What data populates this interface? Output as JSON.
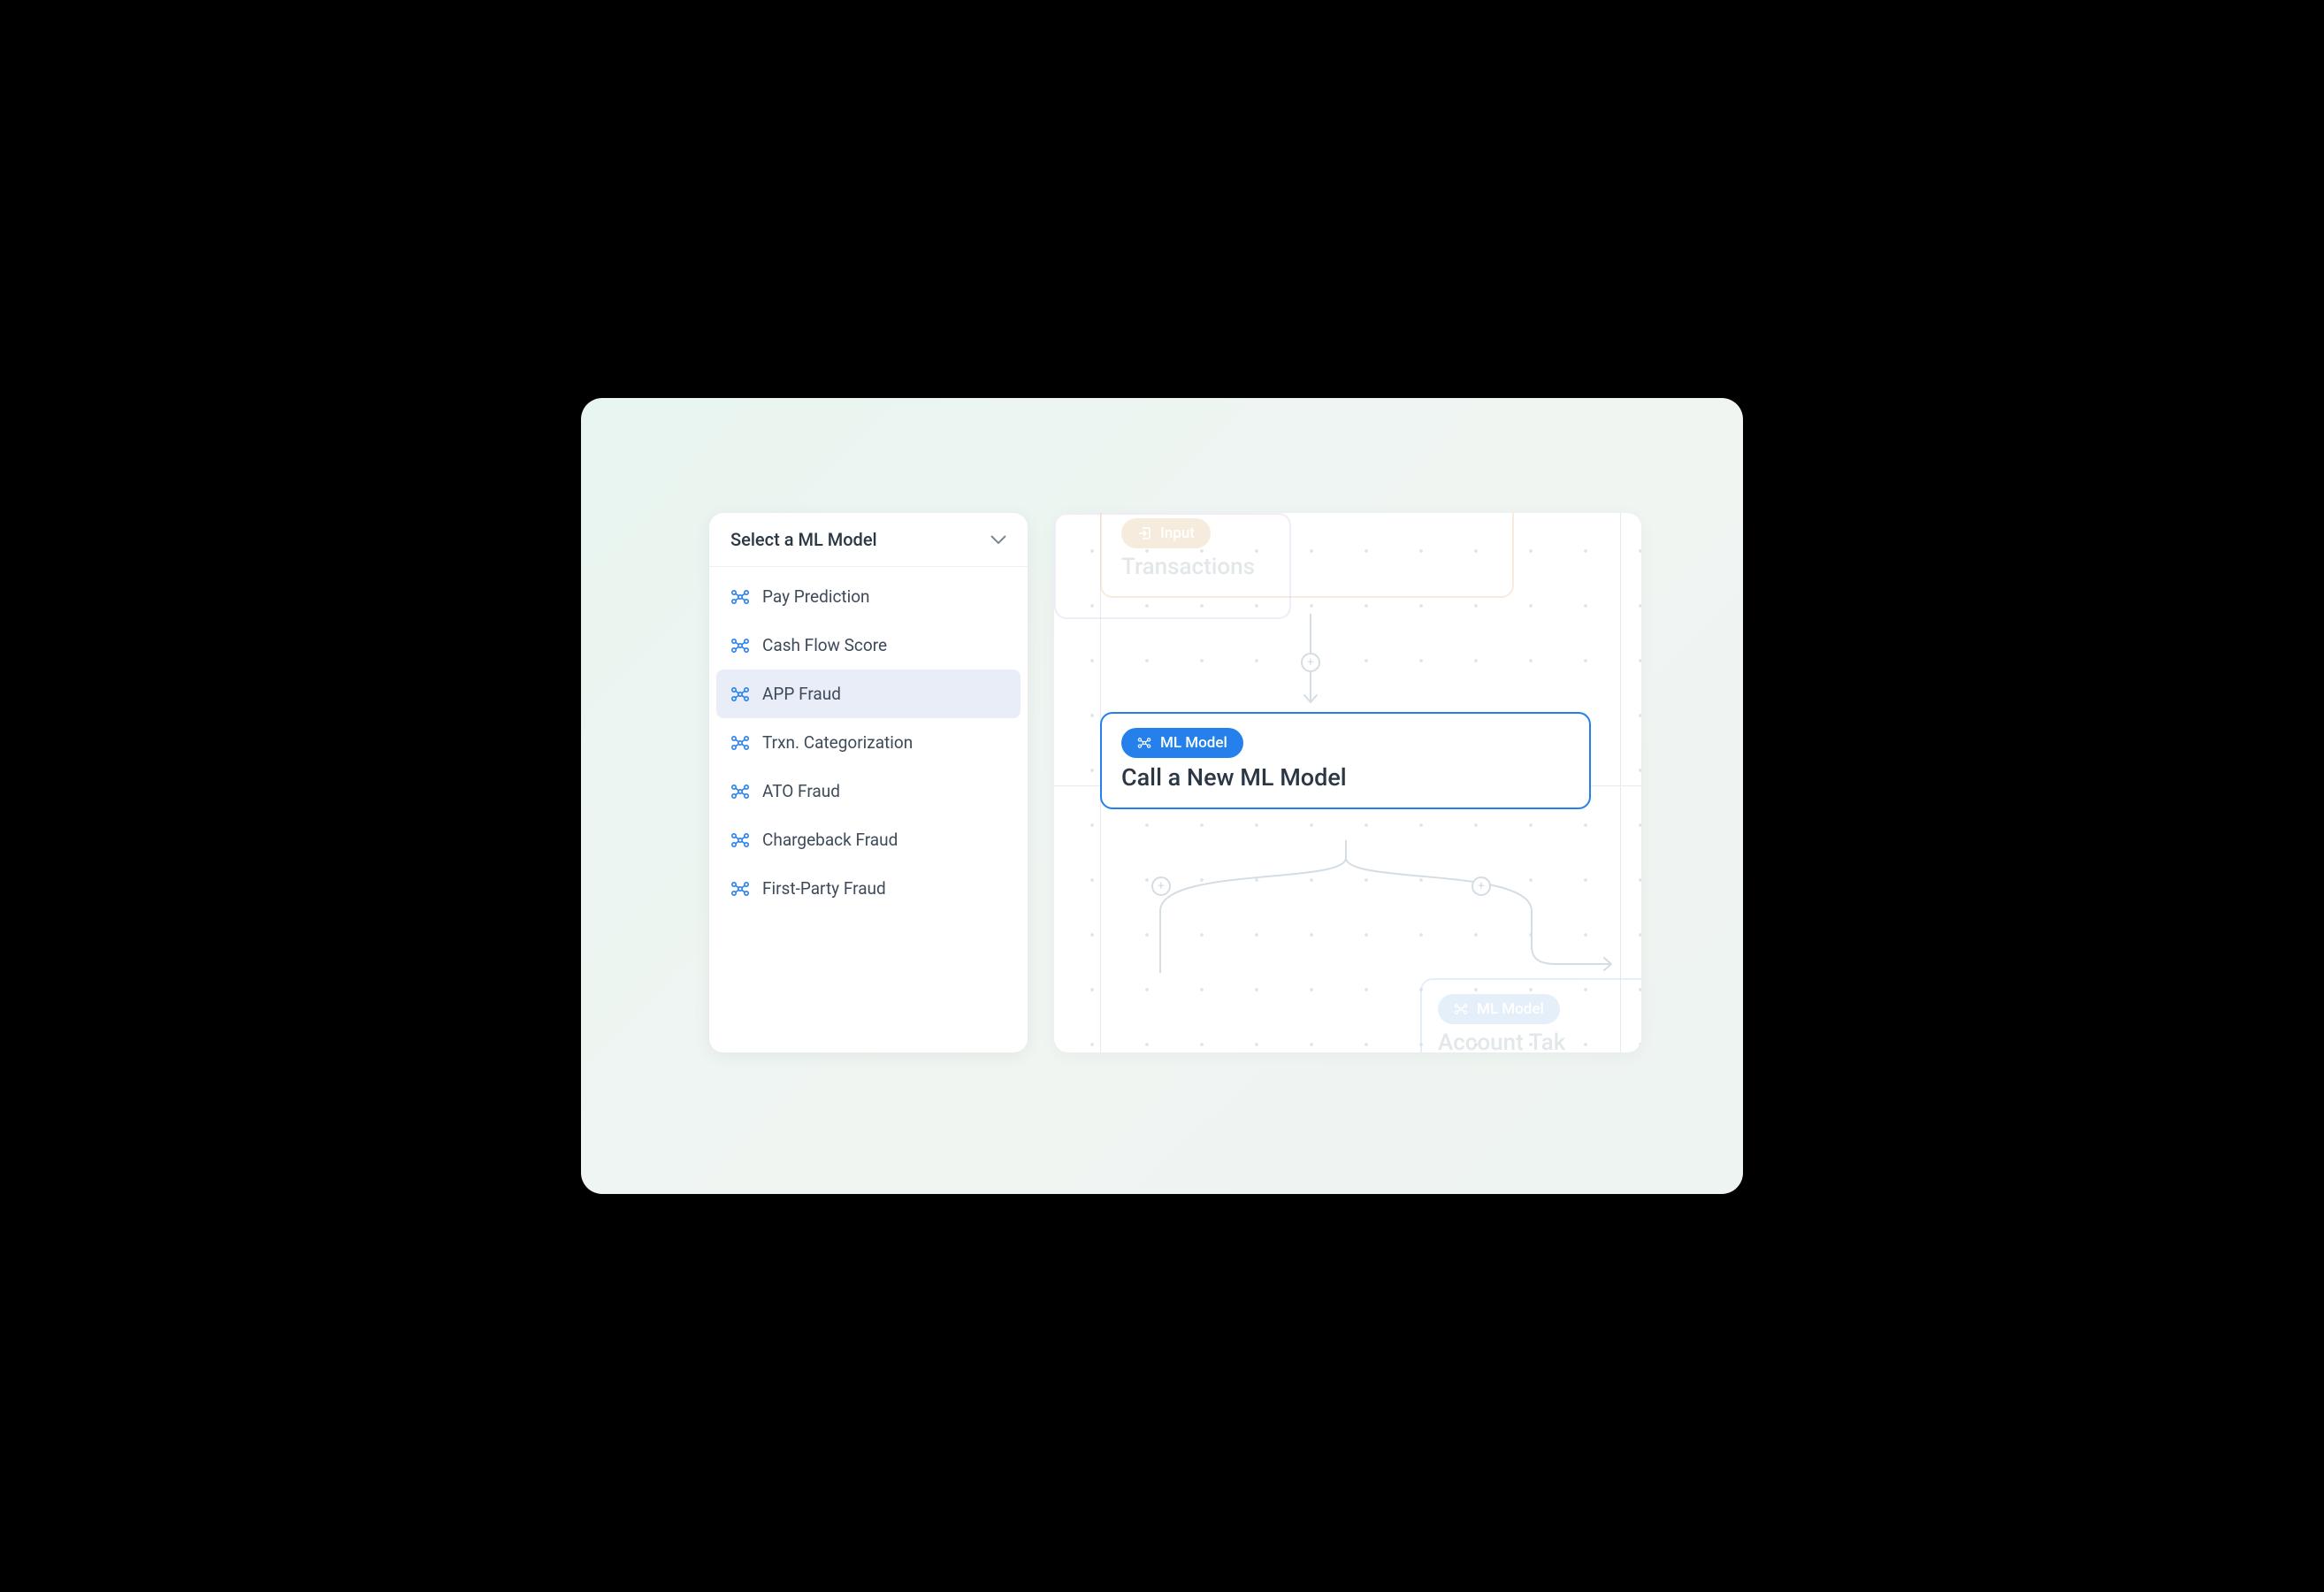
{
  "dropdown": {
    "title": "Select a ML Model",
    "items": [
      {
        "label": "Pay Prediction",
        "selected": false
      },
      {
        "label": "Cash Flow Score",
        "selected": false
      },
      {
        "label": "APP Fraud",
        "selected": true
      },
      {
        "label": "Trxn. Categorization",
        "selected": false
      },
      {
        "label": "ATO Fraud",
        "selected": false
      },
      {
        "label": "Chargeback Fraud",
        "selected": false
      },
      {
        "label": "First-Party Fraud",
        "selected": false
      }
    ]
  },
  "canvas": {
    "input_node": {
      "tag": "Input",
      "title": "Transactions"
    },
    "ml_node": {
      "tag": "ML Model",
      "title": "Call a New ML Model"
    },
    "ml_node_faded": {
      "tag": "ML Model",
      "title": "Account Tak"
    }
  }
}
